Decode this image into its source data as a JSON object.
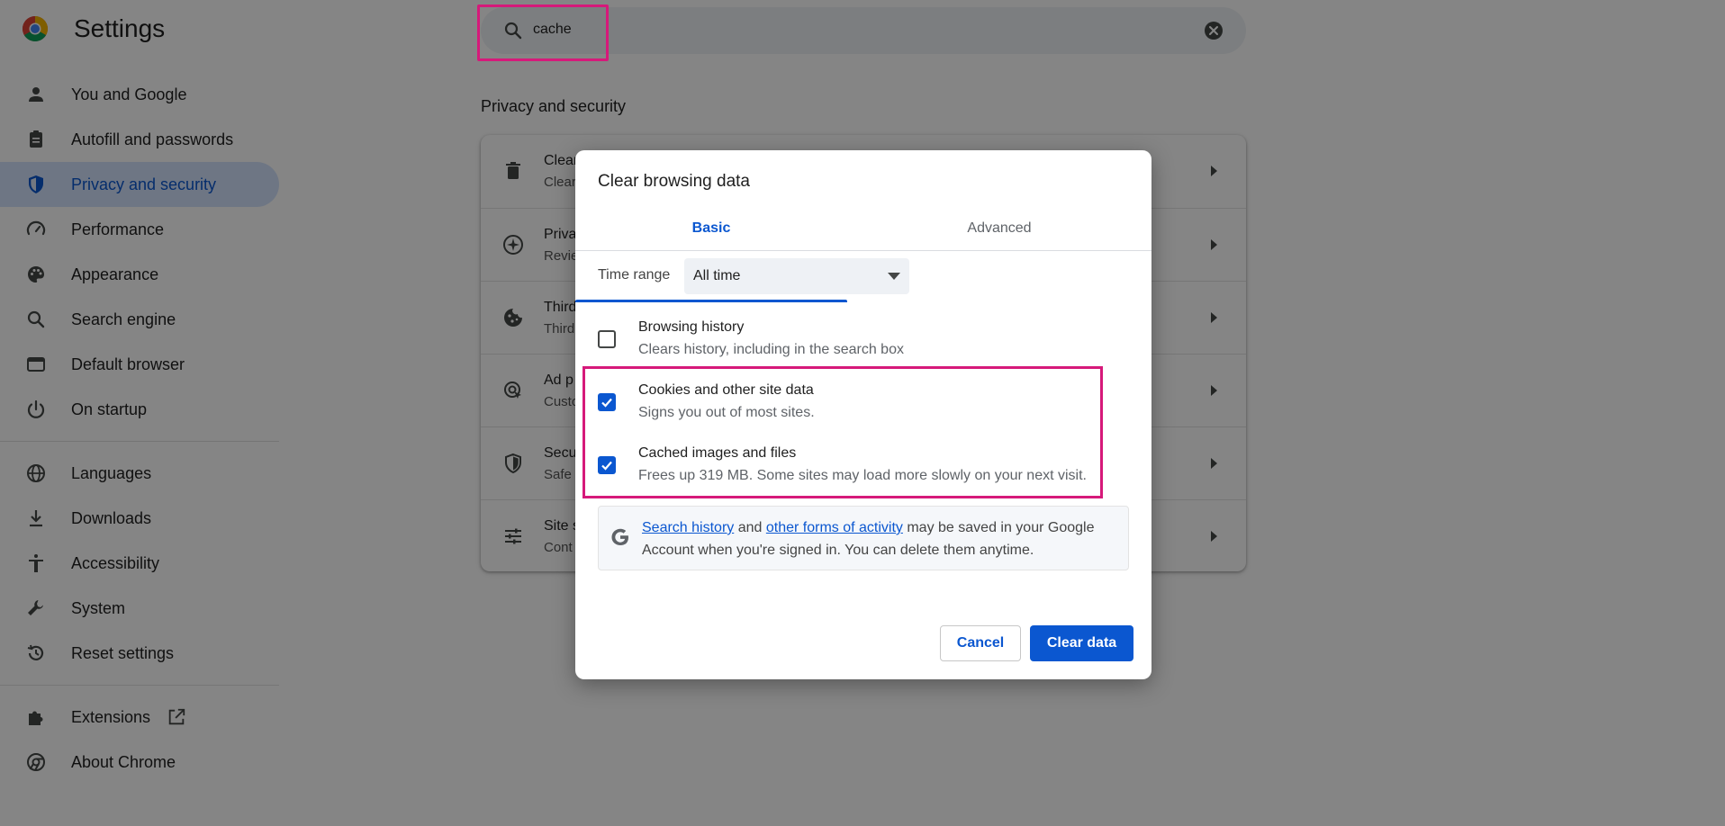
{
  "app": {
    "title": "Settings"
  },
  "search": {
    "value": "cache",
    "icon": "search-icon",
    "clear_icon": "cancel-circle-icon"
  },
  "sidebar": {
    "items": [
      {
        "label": "You and Google",
        "icon": "person-icon"
      },
      {
        "label": "Autofill and passwords",
        "icon": "clipboard-icon"
      },
      {
        "label": "Privacy and security",
        "icon": "shield-icon",
        "active": true
      },
      {
        "label": "Performance",
        "icon": "speedometer-icon"
      },
      {
        "label": "Appearance",
        "icon": "palette-icon"
      },
      {
        "label": "Search engine",
        "icon": "search-icon"
      },
      {
        "label": "Default browser",
        "icon": "browser-window-icon"
      },
      {
        "label": "On startup",
        "icon": "power-icon"
      },
      {
        "label": "Languages",
        "icon": "globe-icon"
      },
      {
        "label": "Downloads",
        "icon": "download-icon"
      },
      {
        "label": "Accessibility",
        "icon": "accessibility-icon"
      },
      {
        "label": "System",
        "icon": "wrench-icon"
      },
      {
        "label": "Reset settings",
        "icon": "history-icon"
      },
      {
        "label": "Extensions",
        "icon": "puzzle-icon"
      },
      {
        "label": "About Chrome",
        "icon": "chrome-icon"
      }
    ]
  },
  "main": {
    "section_title": "Privacy and security",
    "rows": [
      {
        "title": "Clear",
        "subtitle": "Clear",
        "icon": "trash-icon"
      },
      {
        "title": "Priva",
        "subtitle": "Revie",
        "icon": "privacy-guide-icon"
      },
      {
        "title": "Third",
        "subtitle": "Third",
        "icon": "cookie-icon"
      },
      {
        "title": "Ad p",
        "subtitle": "Custo",
        "icon": "ad-privacy-icon"
      },
      {
        "title": "Secu",
        "subtitle": "Safe",
        "icon": "shield-outline-icon"
      },
      {
        "title": "Site s",
        "subtitle": "Cont",
        "icon": "tune-icon"
      }
    ]
  },
  "dialog": {
    "title": "Clear browsing data",
    "tabs": {
      "basic": "Basic",
      "advanced": "Advanced"
    },
    "time_range": {
      "label": "Time range",
      "value": "All time"
    },
    "options": [
      {
        "title": "Browsing history",
        "subtitle": "Clears history, including in the search box",
        "checked": false
      },
      {
        "title": "Cookies and other site data",
        "subtitle": "Signs you out of most sites.",
        "checked": true
      },
      {
        "title": "Cached images and files",
        "subtitle": "Frees up 319 MB. Some sites may load more slowly on your next visit.",
        "checked": true
      }
    ],
    "info": {
      "link1": "Search history",
      "mid1": " and ",
      "link2": "other forms of activity",
      "rest": " may be saved in your Google Account when you're signed in. You can delete them anytime."
    },
    "buttons": {
      "cancel": "Cancel",
      "clear": "Clear data"
    }
  },
  "colors": {
    "accent": "#0b57d0",
    "highlight": "#d6197a",
    "active_nav_bg": "#d3e3fd"
  }
}
